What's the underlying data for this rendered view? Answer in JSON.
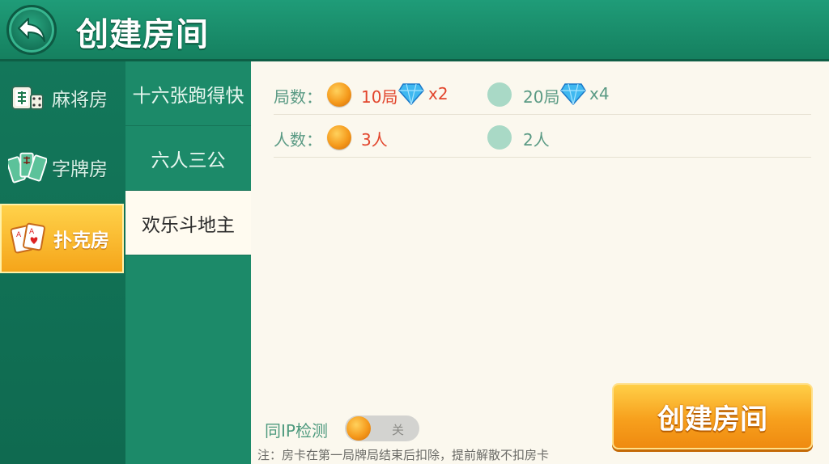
{
  "header": {
    "title": "创建房间",
    "back_icon": "back-arrow-icon"
  },
  "categories": [
    {
      "label": "麻将房",
      "icon": "mahjong-tile-icon",
      "active": false
    },
    {
      "label": "字牌房",
      "icon": "zipai-cards-icon",
      "active": false
    },
    {
      "label": "扑克房",
      "icon": "poker-cards-icon",
      "active": true
    }
  ],
  "games": [
    {
      "label": "十六张跑得快",
      "active": false
    },
    {
      "label": "六人三公",
      "active": false
    },
    {
      "label": "欢乐斗地主",
      "active": true
    }
  ],
  "options": {
    "rounds": {
      "label": "局数：",
      "choices": [
        {
          "label": "10局",
          "cost": "x2",
          "selected": true
        },
        {
          "label": "20局",
          "cost": "x4",
          "selected": false
        }
      ]
    },
    "players": {
      "label": "人数：",
      "choices": [
        {
          "label": "3人",
          "selected": true
        },
        {
          "label": "2人",
          "selected": false
        }
      ]
    }
  },
  "ip_check": {
    "label": "同IP检测",
    "state_text": "关"
  },
  "note": "注：房卡在第一局牌局结束后扣除，提前解散不扣房卡",
  "create_button": "创建房间",
  "colors": {
    "header_green": "#1f9c78",
    "panel_bg": "#fbf8ee",
    "accent_orange": "#f7a01d",
    "selected_text": "#e2452c",
    "label_green": "#5a9a84"
  }
}
